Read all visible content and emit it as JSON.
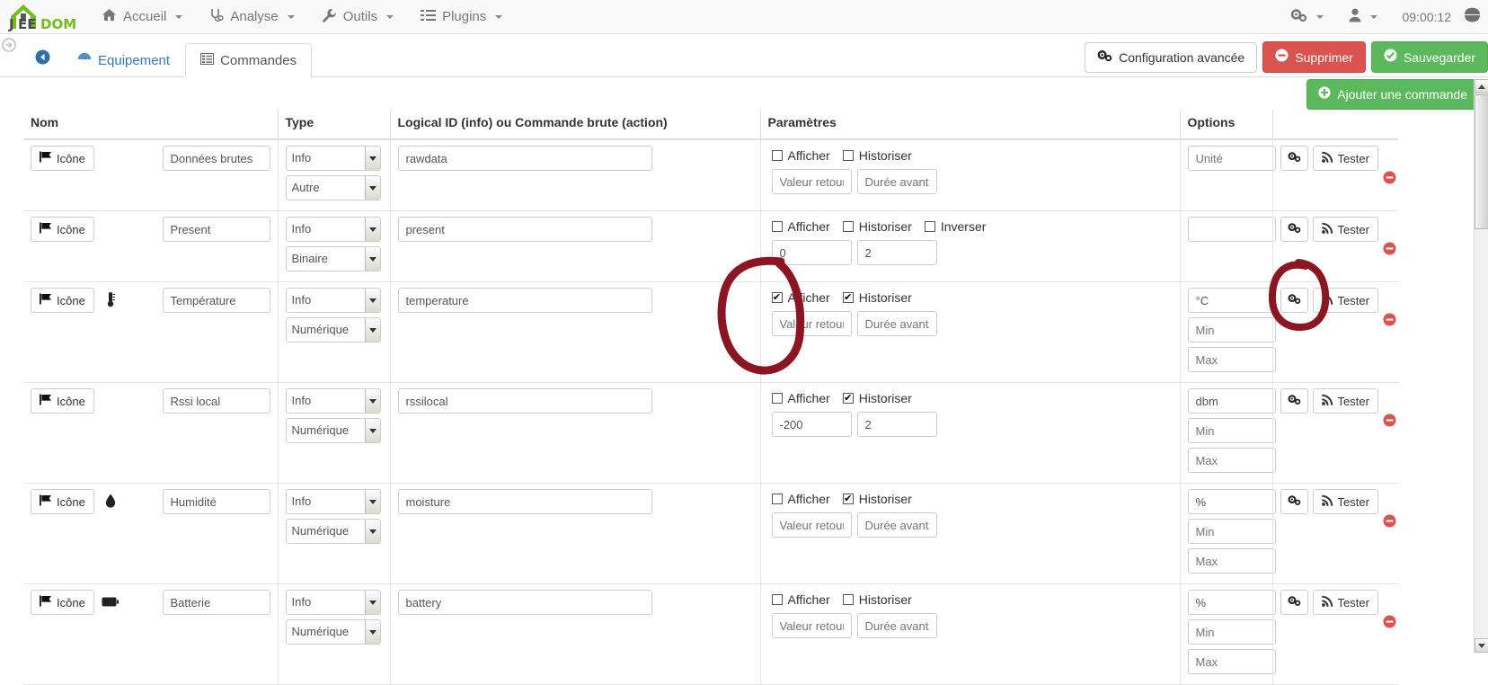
{
  "brand": {
    "name": "JEEDOM"
  },
  "topnav": {
    "items": [
      {
        "label": "Accueil",
        "icon": "home-icon",
        "caret": true
      },
      {
        "label": "Analyse",
        "icon": "stethoscope-icon",
        "caret": true
      },
      {
        "label": "Outils",
        "icon": "wrench-icon",
        "caret": true
      },
      {
        "label": "Plugins",
        "icon": "list-icon",
        "caret": true
      }
    ],
    "right": {
      "gear_icon": "cogs-icon",
      "user_icon": "user-icon",
      "clock": "09:00:12",
      "globe_icon": "globe-icon"
    }
  },
  "tabs": {
    "back_icon": "arrow-left-circle-icon",
    "items": [
      {
        "label": "Equipement",
        "icon": "dashboard-icon",
        "active": false
      },
      {
        "label": "Commandes",
        "icon": "list-alt-icon",
        "active": true
      }
    ]
  },
  "toolbar": {
    "advanced_label": "Configuration avancée",
    "delete_label": "Supprimer",
    "save_label": "Sauvegarder",
    "add_command_label": "Ajouter une commande"
  },
  "table": {
    "headers": [
      "Nom",
      "Type",
      "Logical ID (info) ou Commande brute (action)",
      "Paramètres",
      "Options",
      ""
    ],
    "icon_button_label": "Icône",
    "test_button_label": "Tester",
    "labels": {
      "afficher": "Afficher",
      "historiser": "Historiser",
      "inverser": "Inverser"
    },
    "placeholders": {
      "valeur_retour": "Valeur retour",
      "duree_avant": "Durée avant",
      "unite": "Unité",
      "min": "Min",
      "max": "Max"
    },
    "rows": [
      {
        "icon": "",
        "name": "Données brutes",
        "type": "Info",
        "subtype": "Autre",
        "logical_id": "rawdata",
        "afficher": false,
        "historiser": false,
        "has_inverser": false,
        "inverser": false,
        "param1": "",
        "param1_placeholder": "Valeur retour",
        "param2": "",
        "param2_placeholder": "Durée avant",
        "unit": "",
        "unit_placeholder": "Unité",
        "show_minmax": false,
        "min": "",
        "max": ""
      },
      {
        "icon": "",
        "name": "Present",
        "type": "Info",
        "subtype": "Binaire",
        "logical_id": "present",
        "afficher": false,
        "historiser": false,
        "has_inverser": true,
        "inverser": false,
        "param1": "0",
        "param1_placeholder": "",
        "param2": "2",
        "param2_placeholder": "",
        "unit": "",
        "unit_placeholder": "",
        "show_minmax": false,
        "min": "",
        "max": ""
      },
      {
        "icon": "thermometer-icon",
        "name": "Température",
        "type": "Info",
        "subtype": "Numérique",
        "logical_id": "temperature",
        "afficher": true,
        "historiser": true,
        "has_inverser": false,
        "inverser": false,
        "param1": "",
        "param1_placeholder": "Valeur retour",
        "param2": "",
        "param2_placeholder": "Durée avant",
        "unit": "°C",
        "unit_placeholder": "",
        "show_minmax": true,
        "min": "",
        "max": ""
      },
      {
        "icon": "",
        "name": "Rssi local",
        "type": "Info",
        "subtype": "Numérique",
        "logical_id": "rssilocal",
        "afficher": false,
        "historiser": true,
        "has_inverser": false,
        "inverser": false,
        "param1": "-200",
        "param1_placeholder": "",
        "param2": "2",
        "param2_placeholder": "",
        "unit": "dbm",
        "unit_placeholder": "",
        "show_minmax": true,
        "min": "",
        "max": ""
      },
      {
        "icon": "water-drop-icon",
        "name": "Humidité",
        "type": "Info",
        "subtype": "Numérique",
        "logical_id": "moisture",
        "afficher": false,
        "historiser": true,
        "has_inverser": false,
        "inverser": false,
        "param1": "",
        "param1_placeholder": "Valeur retour",
        "param2": "",
        "param2_placeholder": "Durée avant",
        "unit": "%",
        "unit_placeholder": "",
        "show_minmax": true,
        "min": "",
        "max": ""
      },
      {
        "icon": "battery-icon",
        "name": "Batterie",
        "type": "Info",
        "subtype": "Numérique",
        "logical_id": "battery",
        "afficher": false,
        "historiser": false,
        "has_inverser": false,
        "inverser": false,
        "param1": "",
        "param1_placeholder": "Valeur retour",
        "param2": "",
        "param2_placeholder": "Durée avant",
        "unit": "%",
        "unit_placeholder": "",
        "show_minmax": true,
        "min": "",
        "max": ""
      }
    ]
  },
  "annotations": {
    "color": "#8B1520",
    "shapes": [
      {
        "name": "circle-around-afficher-temperature"
      },
      {
        "name": "circle-around-gear-temperature"
      }
    ]
  }
}
